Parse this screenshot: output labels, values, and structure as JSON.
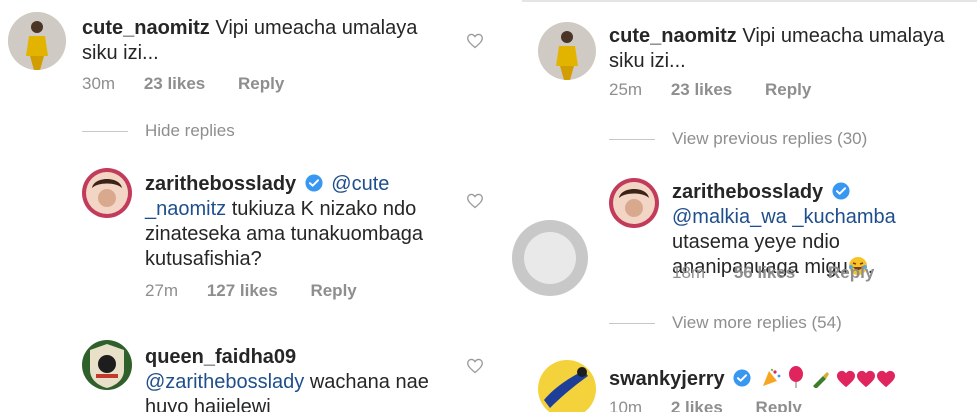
{
  "left": {
    "comments": [
      {
        "username": "cute_naomitz",
        "text": "Vipi umeacha umalaya siku izi...",
        "time": "30m",
        "likes": "23 likes",
        "reply": "Reply"
      },
      {
        "username": "zarithebosslady",
        "mention": "@cute _naomitz",
        "text": "tukiuza K nizako ndo zinateseka ama tunakuombaga kutusafishia?",
        "time": "27m",
        "likes": "127 likes",
        "reply": "Reply"
      },
      {
        "username": "queen_faidha09",
        "mention": "@zarithebosslady",
        "text": "wachana nae huyo hajielewi"
      }
    ],
    "hide_replies": "Hide replies"
  },
  "right": {
    "comments": [
      {
        "username": "cute_naomitz",
        "text": "Vipi umeacha umalaya siku izi...",
        "time": "25m",
        "likes": "23 likes",
        "reply": "Reply"
      },
      {
        "username": "zarithebosslady",
        "mention": "@malkia_wa _kuchamba",
        "text": "utasema yeye ndio ananipanuaga migu",
        "time": "18m",
        "likes": "56 likes",
        "reply": "Reply"
      },
      {
        "username": "swankyjerry",
        "time": "10m",
        "likes": "2 likes",
        "reply": "Reply"
      }
    ],
    "view_previous": "View previous replies (30)",
    "view_more": "View more replies (54)"
  },
  "colors": {
    "verified": "#3897f0",
    "mention": "#1f4e8c",
    "muted": "#8e8e8e",
    "heart": "#e0245e"
  },
  "icons": [
    "heart-outline-icon",
    "verified-badge-icon",
    "laughing-emoji-icon",
    "party-emoji-icon",
    "balloon-emoji-icon",
    "bottle-emoji-icon",
    "red-heart-icon"
  ]
}
